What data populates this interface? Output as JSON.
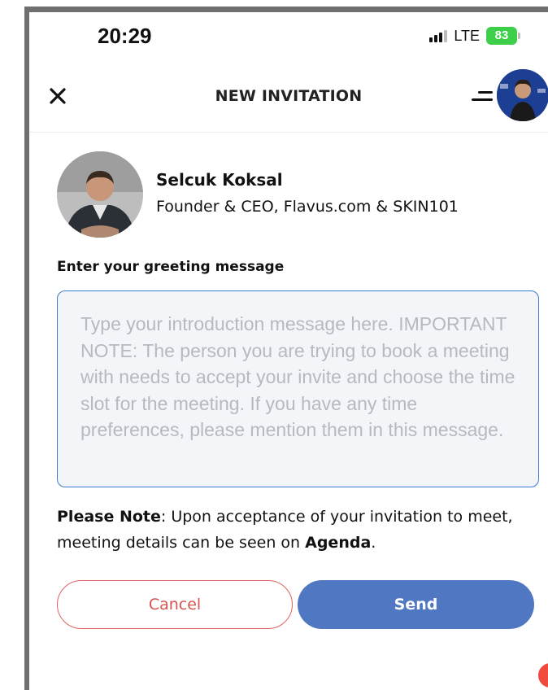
{
  "status_bar": {
    "time": "20:29",
    "network": "LTE",
    "battery": "83",
    "battery_color": "#3ecf4a"
  },
  "header": {
    "title": "NEW INVITATION",
    "close_icon": "close-icon",
    "menu_icon": "menu-icon"
  },
  "profile": {
    "name": "Selcuk Koksal",
    "title": "Founder & CEO, Flavus.com & SKIN101"
  },
  "form": {
    "greeting_label": "Enter your greeting message",
    "message_value": "",
    "message_placeholder": "Type your introduction message here. IMPORTANT NOTE: The person you are trying to book a meeting with needs to accept your invite and choose the time slot for the meeting. If you have any time preferences, please mention them in this message."
  },
  "note": {
    "label": "Please Note",
    "text_before": ": Upon acceptance of your invitation to meet, meeting details can be seen on ",
    "link": "Agenda",
    "text_after": "."
  },
  "actions": {
    "cancel_label": "Cancel",
    "send_label": "Send"
  },
  "colors": {
    "accent": "#4f77c2",
    "cancel": "#d9534f",
    "input_border": "#3f7bcc"
  }
}
